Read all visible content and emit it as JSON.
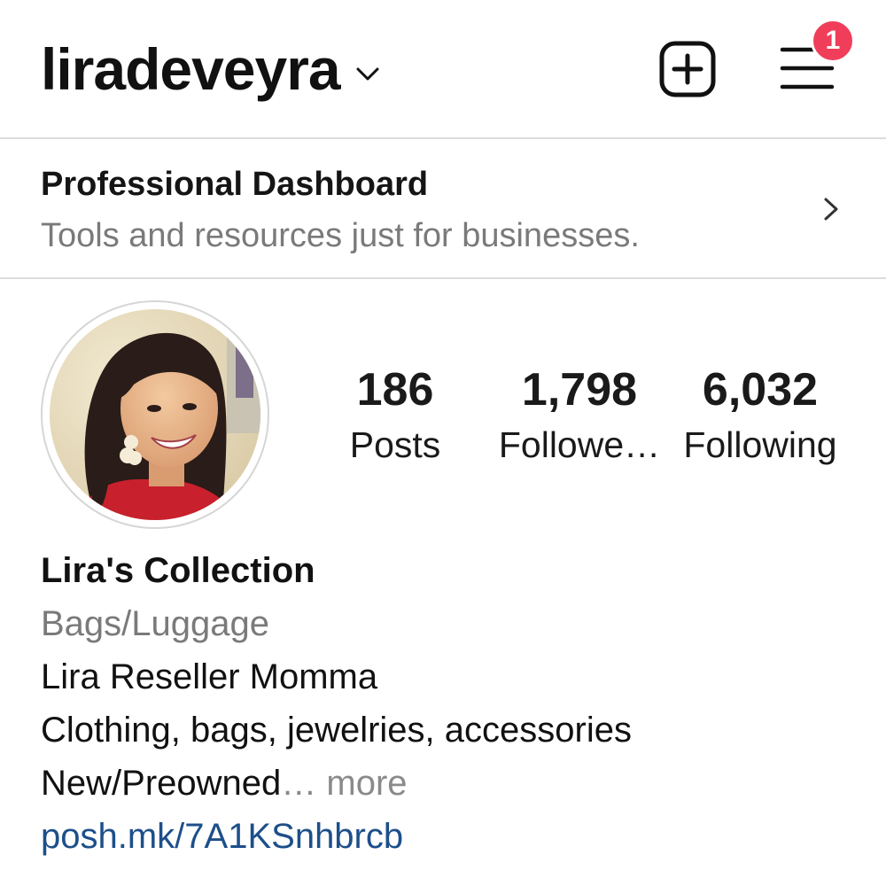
{
  "header": {
    "username": "liradeveyra",
    "chevron_icon": "chevron-down-icon",
    "new_post_icon": "plus-square-icon",
    "menu_icon": "hamburger-menu-icon",
    "notification_badge": "1",
    "badge_color": "#f03e5a"
  },
  "dashboard": {
    "title": "Professional Dashboard",
    "subtitle": "Tools and resources just for businesses.",
    "chevron_icon": "chevron-right-icon"
  },
  "stats": {
    "posts": {
      "count": "186",
      "label": "Posts"
    },
    "followers": {
      "count": "1,798",
      "label": "Followe…"
    },
    "following": {
      "count": "6,032",
      "label": "Following"
    }
  },
  "bio": {
    "name": "Lira's Collection",
    "category": "Bags/Luggage",
    "tagline": "Lira Reseller Momma",
    "description": "Clothing, bags, jewelries, accessories",
    "truncated": "New/Preowned",
    "ellipsis": "…",
    "more": "more",
    "link": "posh.mk/7A1KSnhbrcb",
    "link_color": "#1d4f8a"
  }
}
